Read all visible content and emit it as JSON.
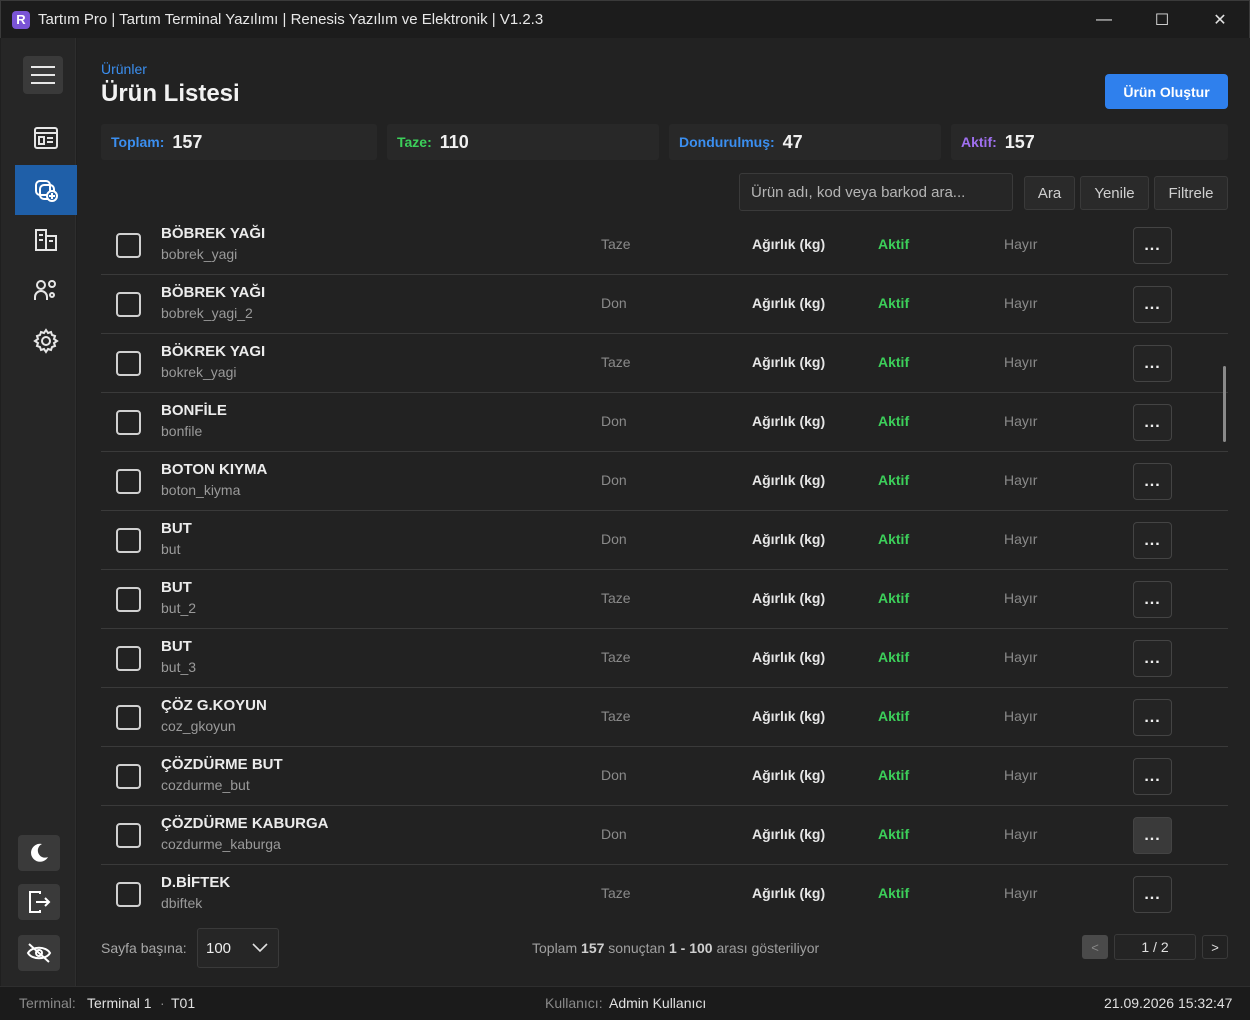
{
  "window": {
    "logo": "R",
    "title": "Tartım Pro | Tartım Terminal Yazılımı | Renesis Yazılım ve Elektronik | V1.2.3",
    "minimize": "—",
    "maximize": "☐",
    "close": "✕"
  },
  "sidebar": {
    "items": [
      {
        "icon": "dashboard-icon",
        "active": false
      },
      {
        "icon": "products-add-icon",
        "active": true
      },
      {
        "icon": "buildings-icon",
        "active": false
      },
      {
        "icon": "groups-icon",
        "active": false
      },
      {
        "icon": "gear-icon",
        "active": false
      }
    ],
    "bottom": [
      {
        "icon": "moon-icon"
      },
      {
        "icon": "logout-icon"
      },
      {
        "icon": "eye-off-icon"
      }
    ]
  },
  "header": {
    "breadcrumb": "Ürünler",
    "title": "Ürün Listesi",
    "create_button": "Ürün Oluştur"
  },
  "stats": [
    {
      "label": "Toplam:",
      "value": "157",
      "color": "#3b8ff0"
    },
    {
      "label": "Taze:",
      "value": "110",
      "color": "#3ccf5a"
    },
    {
      "label": "Dondurulmuş:",
      "value": "47",
      "color": "#3b8ff0"
    },
    {
      "label": "Aktif:",
      "value": "157",
      "color": "#a070f0"
    }
  ],
  "toolbar": {
    "search_placeholder": "Ürün adı, kod veya barkod ara...",
    "search_button": "Ara",
    "refresh_button": "Yenile",
    "filter_button": "Filtrele"
  },
  "rows": [
    {
      "name": "BÖBREK YAĞI",
      "code": "bobrek_yagi",
      "type": "Taze",
      "unit": "Ağırlık (kg)",
      "status": "Aktif",
      "flag": "Hayır",
      "more": "..."
    },
    {
      "name": "BÖBREK YAĞI",
      "code": "bobrek_yagi_2",
      "type": "Don",
      "unit": "Ağırlık (kg)",
      "status": "Aktif",
      "flag": "Hayır",
      "more": "..."
    },
    {
      "name": "BÖKREK YAGI",
      "code": "bokrek_yagi",
      "type": "Taze",
      "unit": "Ağırlık (kg)",
      "status": "Aktif",
      "flag": "Hayır",
      "more": "..."
    },
    {
      "name": "BONFİLE",
      "code": "bonfile",
      "type": "Don",
      "unit": "Ağırlık (kg)",
      "status": "Aktif",
      "flag": "Hayır",
      "more": "..."
    },
    {
      "name": "BOTON KIYMA",
      "code": "boton_kiyma",
      "type": "Don",
      "unit": "Ağırlık (kg)",
      "status": "Aktif",
      "flag": "Hayır",
      "more": "..."
    },
    {
      "name": "BUT",
      "code": "but",
      "type": "Don",
      "unit": "Ağırlık (kg)",
      "status": "Aktif",
      "flag": "Hayır",
      "more": "..."
    },
    {
      "name": "BUT",
      "code": "but_2",
      "type": "Taze",
      "unit": "Ağırlık (kg)",
      "status": "Aktif",
      "flag": "Hayır",
      "more": "..."
    },
    {
      "name": "BUT",
      "code": "but_3",
      "type": "Taze",
      "unit": "Ağırlık (kg)",
      "status": "Aktif",
      "flag": "Hayır",
      "more": "..."
    },
    {
      "name": "ÇÖZ G.KOYUN",
      "code": "coz_gkoyun",
      "type": "Taze",
      "unit": "Ağırlık (kg)",
      "status": "Aktif",
      "flag": "Hayır",
      "more": "..."
    },
    {
      "name": "ÇÖZDÜRME BUT",
      "code": "cozdurme_but",
      "type": "Don",
      "unit": "Ağırlık (kg)",
      "status": "Aktif",
      "flag": "Hayır",
      "more": "..."
    },
    {
      "name": "ÇÖZDÜRME KABURGA",
      "code": "cozdurme_kaburga",
      "type": "Don",
      "unit": "Ağırlık (kg)",
      "status": "Aktif",
      "flag": "Hayır",
      "more": "..."
    },
    {
      "name": "D.BİFTEK",
      "code": "dbiftek",
      "type": "Taze",
      "unit": "Ağırlık (kg)",
      "status": "Aktif",
      "flag": "Hayır",
      "more": "..."
    }
  ],
  "pagination": {
    "per_page_label": "Sayfa başına:",
    "per_page_value": "100",
    "summary_prefix": "Toplam",
    "total": "157",
    "summary_mid": "sonuçtan",
    "range": "1 - 100",
    "summary_suffix": "arası gösteriliyor",
    "prev": "<",
    "page": "1 / 2",
    "next": ">"
  },
  "statusbar": {
    "terminal_label": "Terminal:",
    "terminal_name": "Terminal 1",
    "separator": "·",
    "terminal_code": "T01",
    "user_label": "Kullanıcı:",
    "user_name": "Admin Kullanıcı",
    "datetime": "21.09.2026 15:32:47"
  }
}
